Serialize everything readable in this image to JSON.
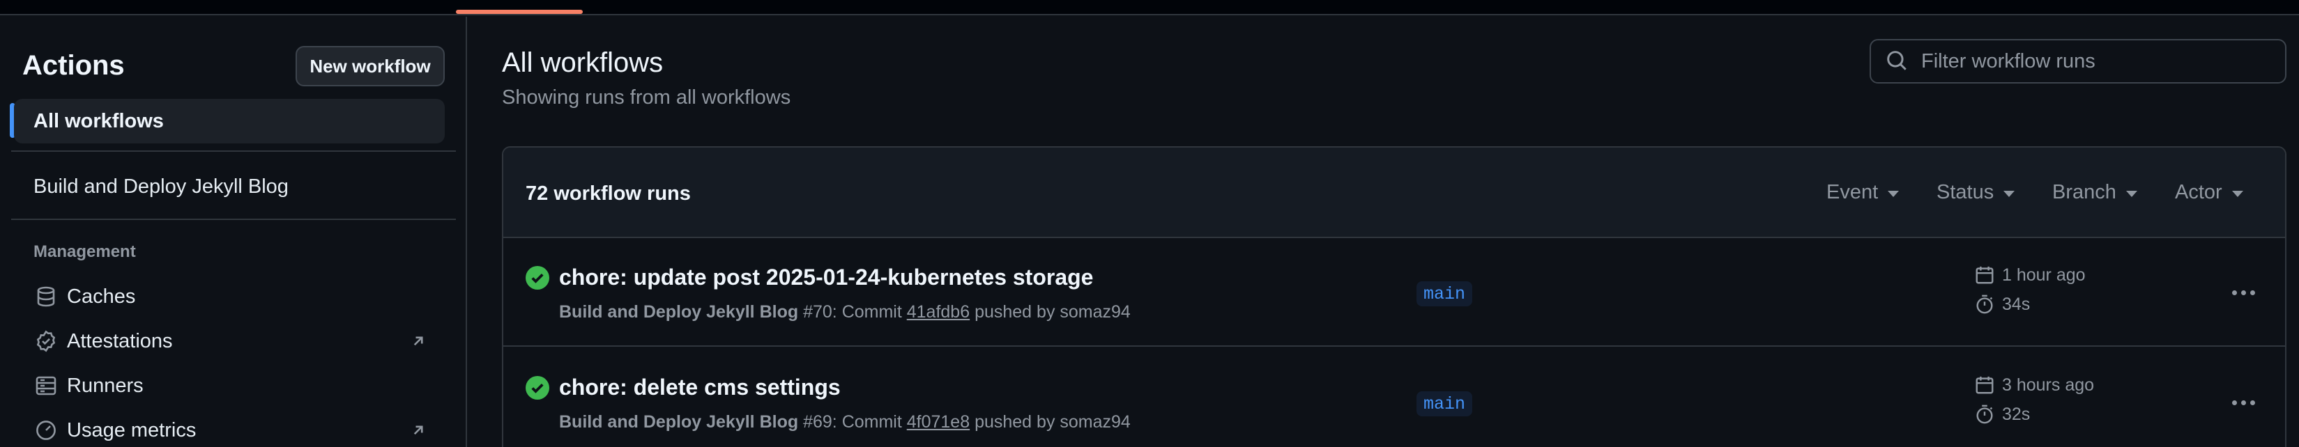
{
  "sidebar": {
    "title": "Actions",
    "new_workflow_label": "New workflow",
    "active_item": "All workflows",
    "workflow_item": "Build and Deploy Jekyll Blog",
    "section_label": "Management",
    "management": [
      {
        "label": "Caches",
        "icon": "database-icon",
        "external": false
      },
      {
        "label": "Attestations",
        "icon": "verified-icon",
        "external": true
      },
      {
        "label": "Runners",
        "icon": "server-icon",
        "external": false
      },
      {
        "label": "Usage metrics",
        "icon": "meter-icon",
        "external": true
      }
    ]
  },
  "main": {
    "title": "All workflows",
    "subtitle": "Showing runs from all workflows",
    "filter_placeholder": "Filter workflow runs"
  },
  "runs": {
    "count_label": "72 workflow runs",
    "filters": [
      "Event",
      "Status",
      "Branch",
      "Actor"
    ],
    "items": [
      {
        "title": "chore: update post 2025-01-24-kubernetes storage",
        "workflow": "Build and Deploy Jekyll Blog",
        "number": "#70",
        "commit_prefix": ": Commit ",
        "sha": "41afdb6",
        "pushed_by": " pushed by somaz94",
        "branch": "main",
        "time_ago": "1 hour ago",
        "duration": "34s",
        "status": "success"
      },
      {
        "title": "chore: delete cms settings",
        "workflow": "Build and Deploy Jekyll Blog",
        "number": "#69",
        "commit_prefix": ": Commit ",
        "sha": "4f071e8",
        "pushed_by": " pushed by somaz94",
        "branch": "main",
        "time_ago": "3 hours ago",
        "duration": "32s",
        "status": "success"
      }
    ]
  },
  "colors": {
    "background": "#0d1117",
    "accent": "#4493f8",
    "success": "#3fb950",
    "tab_underline": "#f78166"
  }
}
